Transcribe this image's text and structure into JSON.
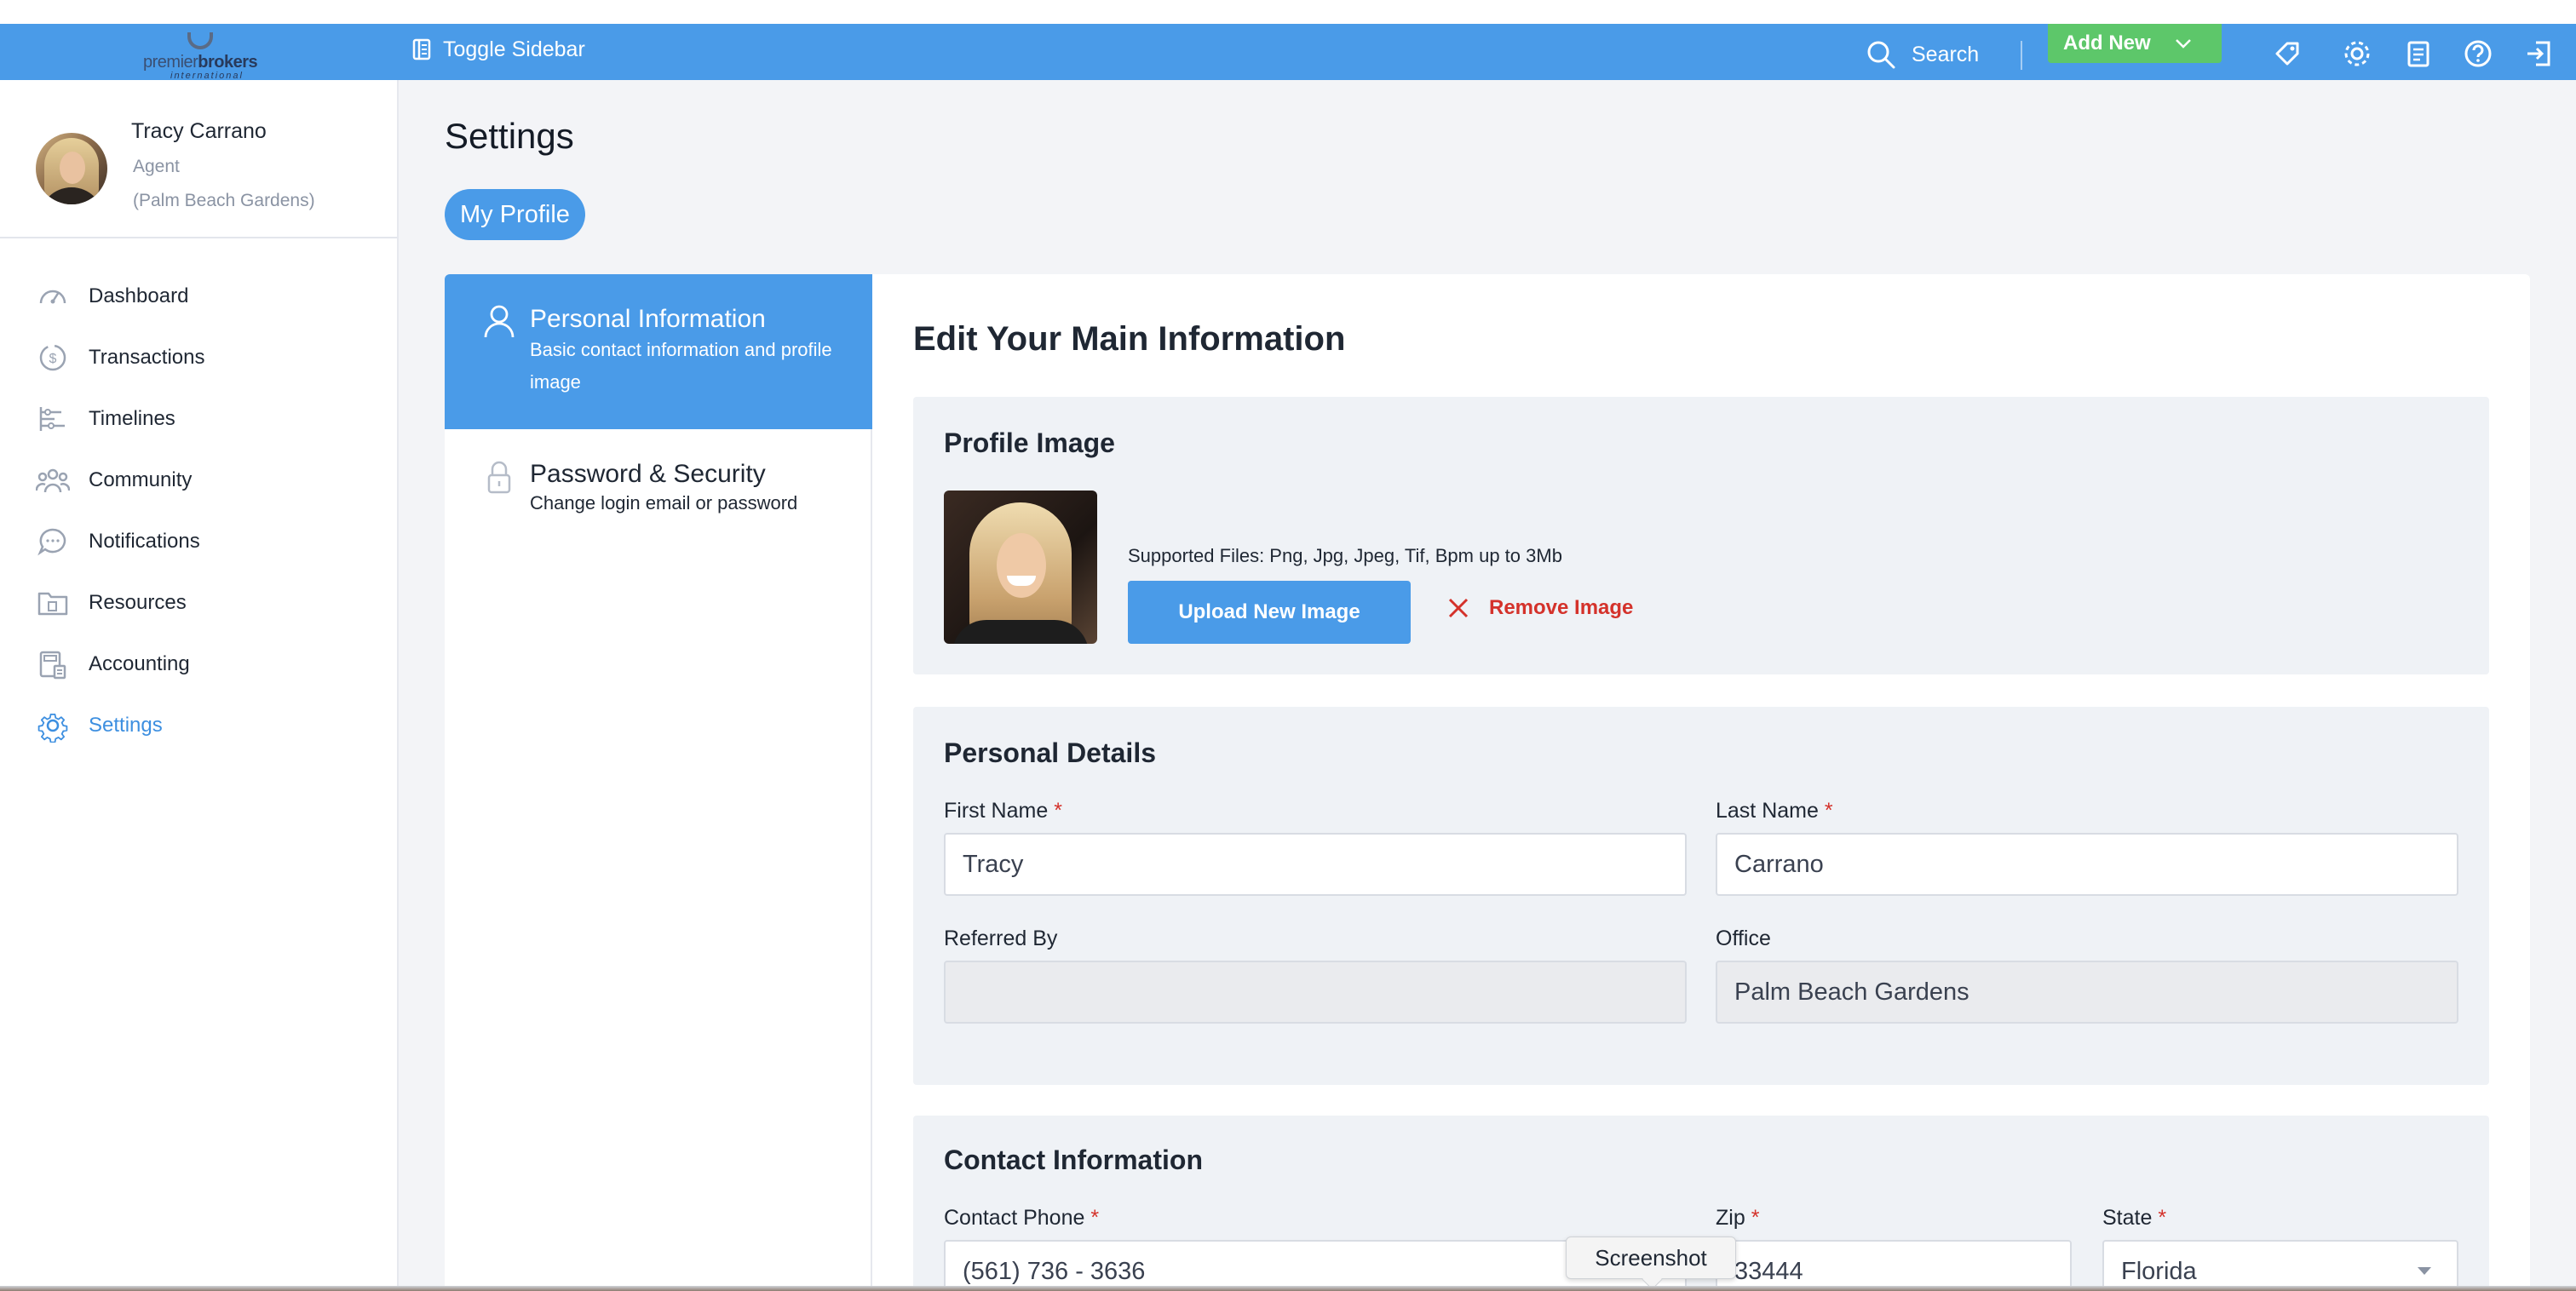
{
  "header": {
    "logo_text_a": "premier",
    "logo_text_b": "brokers",
    "logo_sub": "international",
    "toggle_sidebar": "Toggle Sidebar",
    "search": "Search",
    "add_new": "Add New"
  },
  "user": {
    "name": "Tracy Carrano",
    "role": "Agent",
    "office": "(Palm Beach Gardens)"
  },
  "sidebar": {
    "items": [
      {
        "label": "Dashboard",
        "icon": "gauge-icon"
      },
      {
        "label": "Transactions",
        "icon": "dollar-circle-icon"
      },
      {
        "label": "Timelines",
        "icon": "timeline-icon"
      },
      {
        "label": "Community",
        "icon": "people-icon"
      },
      {
        "label": "Notifications",
        "icon": "chat-bubble-icon"
      },
      {
        "label": "Resources",
        "icon": "folder-icon"
      },
      {
        "label": "Accounting",
        "icon": "calculator-icon"
      },
      {
        "label": "Settings",
        "icon": "gear-icon",
        "active": true
      }
    ]
  },
  "page": {
    "title": "Settings",
    "pill": "My Profile"
  },
  "tabs": {
    "personal_title": "Personal Information",
    "personal_sub": "Basic contact information and profile image",
    "security_title": "Password & Security",
    "security_sub": "Change login email or password"
  },
  "main": {
    "heading": "Edit Your Main Information",
    "profile_image": {
      "title": "Profile Image",
      "supported": "Supported Files: Png, Jpg, Jpeg, Tif, Bpm up to 3Mb",
      "upload": "Upload New Image",
      "remove": "Remove Image"
    },
    "personal": {
      "title": "Personal Details",
      "first_name_label": "First Name",
      "first_name": "Tracy",
      "last_name_label": "Last Name",
      "last_name": "Carrano",
      "referred_by_label": "Referred By",
      "referred_by": "",
      "office_label": "Office",
      "office": "Palm Beach Gardens"
    },
    "contact": {
      "title": "Contact Information",
      "phone_label": "Contact Phone",
      "phone": "(561) 736 - 3636",
      "zip_label": "Zip",
      "zip": "33444",
      "state_label": "State",
      "state": "Florida"
    },
    "required_mark": "*"
  },
  "tooltip": "Screenshot",
  "colors": {
    "header": "#4a9be8",
    "add_new": "#5dc76a",
    "danger": "#d4322b",
    "active_nav": "#3d8fe0"
  }
}
